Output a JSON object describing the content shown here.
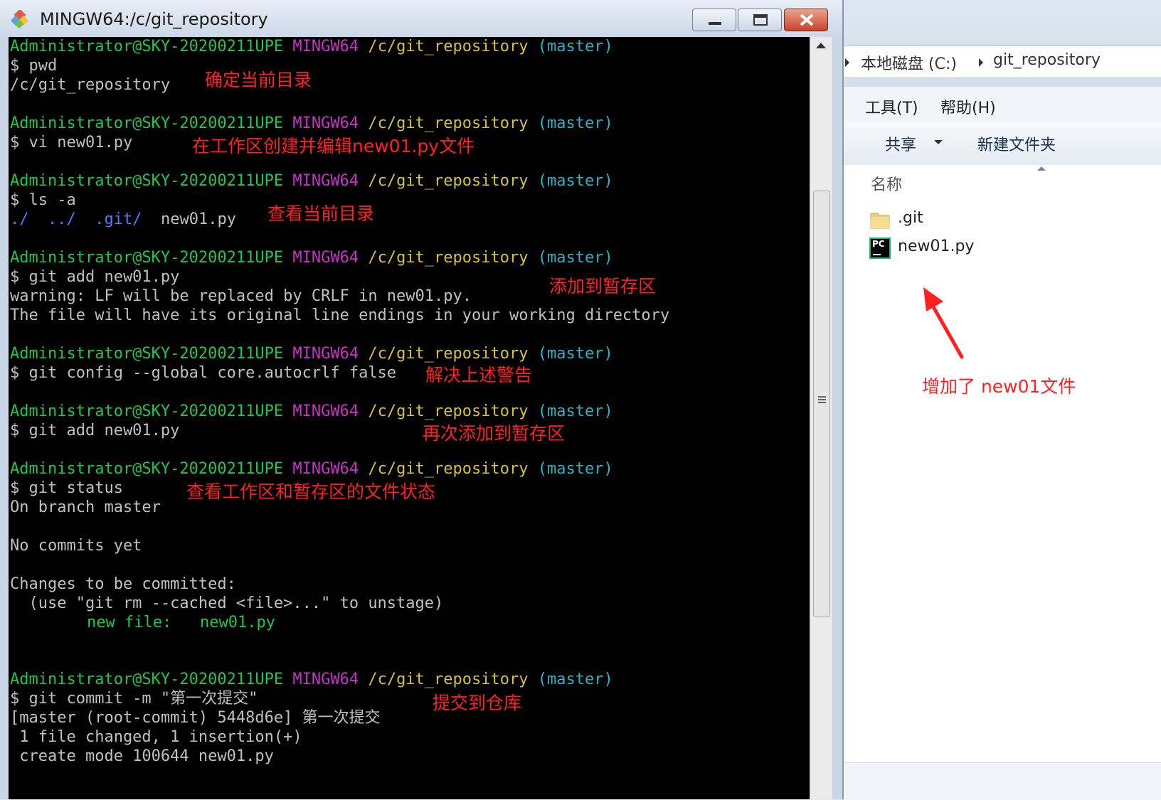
{
  "terminal": {
    "title": "MINGW64:/c/git_repository",
    "prompt": {
      "user_host": "Administrator@SKY-20200211UPE",
      "system": "MINGW64",
      "path": "/c/git_repository",
      "branch": "(master)"
    },
    "lines": {
      "cmd_pwd": "$ pwd",
      "out_pwd": "/c/git_repository",
      "cmd_vi": "$ vi new01.py",
      "cmd_ls": "$ ls -a",
      "ls_dot": "./",
      "ls_dotdot": "../",
      "ls_git": ".git/",
      "ls_new01": "new01.py",
      "cmd_add1": "$ git add new01.py",
      "warn1": "warning: LF will be replaced by CRLF in new01.py.",
      "warn2": "The file will have its original line endings in your working directory",
      "cmd_config": "$ git config --global core.autocrlf false",
      "cmd_add2": "$ git add new01.py",
      "cmd_status": "$ git status",
      "status1": "On branch master",
      "status2": "No commits yet",
      "status3": "Changes to be committed:",
      "status4": "  (use \"git rm --cached <file>...\" to unstage)",
      "status5_label": "new file:",
      "status5_file": "new01.py",
      "cmd_commit": "$ git commit -m \"第一次提交\"",
      "commit1": "[master (root-commit) 5448d6e] 第一次提交",
      "commit2": " 1 file changed, 1 insertion(+)",
      "commit3": " create mode 100644 new01.py"
    },
    "notes": {
      "n1": "确定当前目录",
      "n2": "在工作区创建并编辑new01.py文件",
      "n3": "查看当前目录",
      "n4": "添加到暂存区",
      "n5": "解决上述警告",
      "n6": "再次添加到暂存区",
      "n7": "查看工作区和暂存区的文件状态",
      "n8": "提交到仓库"
    }
  },
  "explorer": {
    "breadcrumb": [
      "本地磁盘 (C:)",
      "git_repository"
    ],
    "menu": [
      "工具(T)",
      "帮助(H)"
    ],
    "toolbar": {
      "share": "共享",
      "new_folder": "新建文件夹"
    },
    "column_header": "名称",
    "files": [
      ".git",
      "new01.py"
    ],
    "pc_badge": "PC",
    "annotation": "增加了 new01文件"
  },
  "colors": {
    "terminal_bg": "#000000",
    "prompt_user": "#1ec84a",
    "prompt_system": "#c832c8",
    "prompt_path": "#d6c23a",
    "prompt_branch": "#28b4c8",
    "annotation": "#ff2020"
  }
}
